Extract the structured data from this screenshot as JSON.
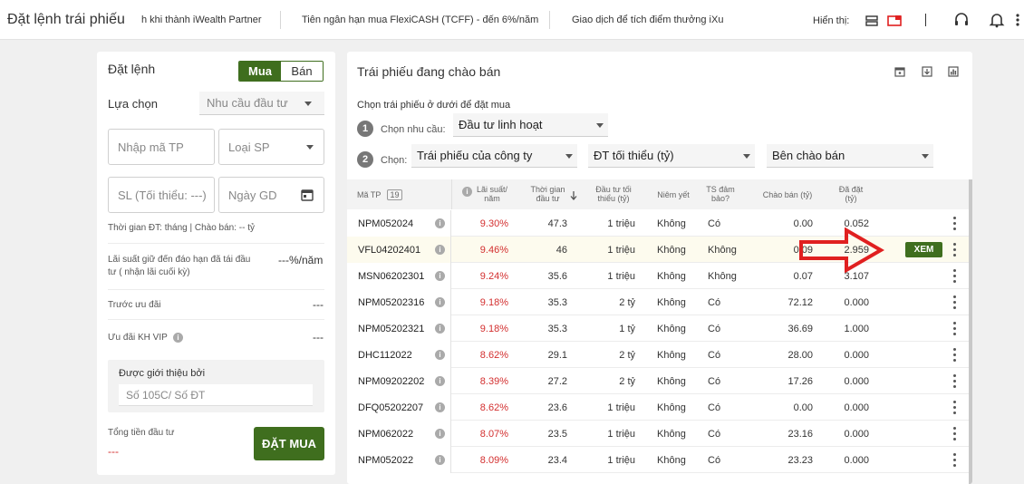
{
  "topbar": {
    "title": "Đặt lệnh trái phiếu",
    "tickers": [
      "h khi thành iWealth Partner",
      "Tiên ngân hạn mua FlexiCASH (TCFF) - đến 6%/năm",
      "Giao dịch để tích điểm thưởng iXu"
    ],
    "view_label": "Hiển thị:",
    "icons": [
      "list-view-icon",
      "card-view-icon",
      "headset-icon",
      "bell-icon",
      "more-vert-icon"
    ]
  },
  "order": {
    "title": "Đặt lệnh",
    "buy_label": "Mua",
    "sell_label": "Bán",
    "choose_label": "Lựa chọn",
    "need_placeholder": "Nhu cầu đầu tư",
    "code_placeholder": "Nhập mã TP",
    "type_placeholder": "Loại SP",
    "qty_placeholder": "SL (Tối thiểu: ---)",
    "date_placeholder": "Ngày GD",
    "term_text": "Thời gian ĐT:  tháng  |  Chào bán: -- tỷ",
    "interest_label": "Lãi suất giữ đến đáo hạn đã tái đầu tư ( nhận lãi cuối kỳ)",
    "interest_value": "---%/năm",
    "pre_discount_label": "Trước ưu đãi",
    "pre_discount_value": "---",
    "vip_label": "Ưu đãi KH VIP",
    "vip_value": "---",
    "referrer_label": "Được giới thiệu bởi",
    "referrer_placeholder": "Số 105C/ Số ĐT",
    "total_label": "Tổng tiền đầu tư",
    "total_value": "---",
    "submit_label": "ĐẶT MUA"
  },
  "bonds": {
    "title": "Trái phiếu đang chào bán",
    "subtitle": "Chọn trái phiếu ở dưới để đặt mua",
    "step1_num": "1",
    "step1_label": "Chọn nhu cầu:",
    "step1_value": "Đầu tư linh hoạt",
    "step2_num": "2",
    "step2_label": "Chọn:",
    "filter_issuer": "Trái phiếu của công ty",
    "filter_min": "ĐT tối thiểu (tỷ)",
    "filter_seller": "Bên chào bán",
    "columns": {
      "code": "Mã TP",
      "count": "19",
      "rate": "Lãi suất/ năm",
      "term": "Thời gian đầu tư",
      "min": "Đầu tư tối thiểu (tỷ)",
      "listed": "Niêm yết",
      "secured": "TS đảm bảo?",
      "offered": "Chào bán (tỷ)",
      "reached": "Đã đặt (tỷ)"
    },
    "view_button": "XEM",
    "rows": [
      {
        "code": "NPM052024",
        "rate": "9.30%",
        "term": "47.3",
        "min": "1 triệu",
        "listed": "Không",
        "secured": "Có",
        "offered": "0.00",
        "reached": "0.052"
      },
      {
        "code": "VFL04202401",
        "rate": "9.46%",
        "term": "46",
        "min": "1 triệu",
        "listed": "Không",
        "secured": "Không",
        "offered": "0.09",
        "reached": "2.959"
      },
      {
        "code": "MSN06202301",
        "rate": "9.24%",
        "term": "35.6",
        "min": "1 triệu",
        "listed": "Không",
        "secured": "Không",
        "offered": "0.07",
        "reached": "3.107"
      },
      {
        "code": "NPM05202316",
        "rate": "9.18%",
        "term": "35.3",
        "min": "2 tỷ",
        "listed": "Không",
        "secured": "Có",
        "offered": "72.12",
        "reached": "0.000"
      },
      {
        "code": "NPM05202321",
        "rate": "9.18%",
        "term": "35.3",
        "min": "1 tỷ",
        "listed": "Không",
        "secured": "Có",
        "offered": "36.69",
        "reached": "1.000"
      },
      {
        "code": "DHC112022",
        "rate": "8.62%",
        "term": "29.1",
        "min": "2 tỷ",
        "listed": "Không",
        "secured": "Có",
        "offered": "28.00",
        "reached": "0.000"
      },
      {
        "code": "NPM09202202",
        "rate": "8.39%",
        "term": "27.2",
        "min": "2 tỷ",
        "listed": "Không",
        "secured": "Có",
        "offered": "17.26",
        "reached": "0.000"
      },
      {
        "code": "DFQ05202207",
        "rate": "8.62%",
        "term": "23.6",
        "min": "1 triệu",
        "listed": "Không",
        "secured": "Có",
        "offered": "0.00",
        "reached": "0.000"
      },
      {
        "code": "NPM062022",
        "rate": "8.07%",
        "term": "23.5",
        "min": "1 triệu",
        "listed": "Không",
        "secured": "Có",
        "offered": "23.16",
        "reached": "0.000"
      },
      {
        "code": "NPM052022",
        "rate": "8.09%",
        "term": "23.4",
        "min": "1 triệu",
        "listed": "Không",
        "secured": "Có",
        "offered": "23.23",
        "reached": "0.000"
      }
    ]
  },
  "colors": {
    "accent": "#3f6e1e",
    "rate": "#d32f2f",
    "annotation": "#e02020"
  }
}
